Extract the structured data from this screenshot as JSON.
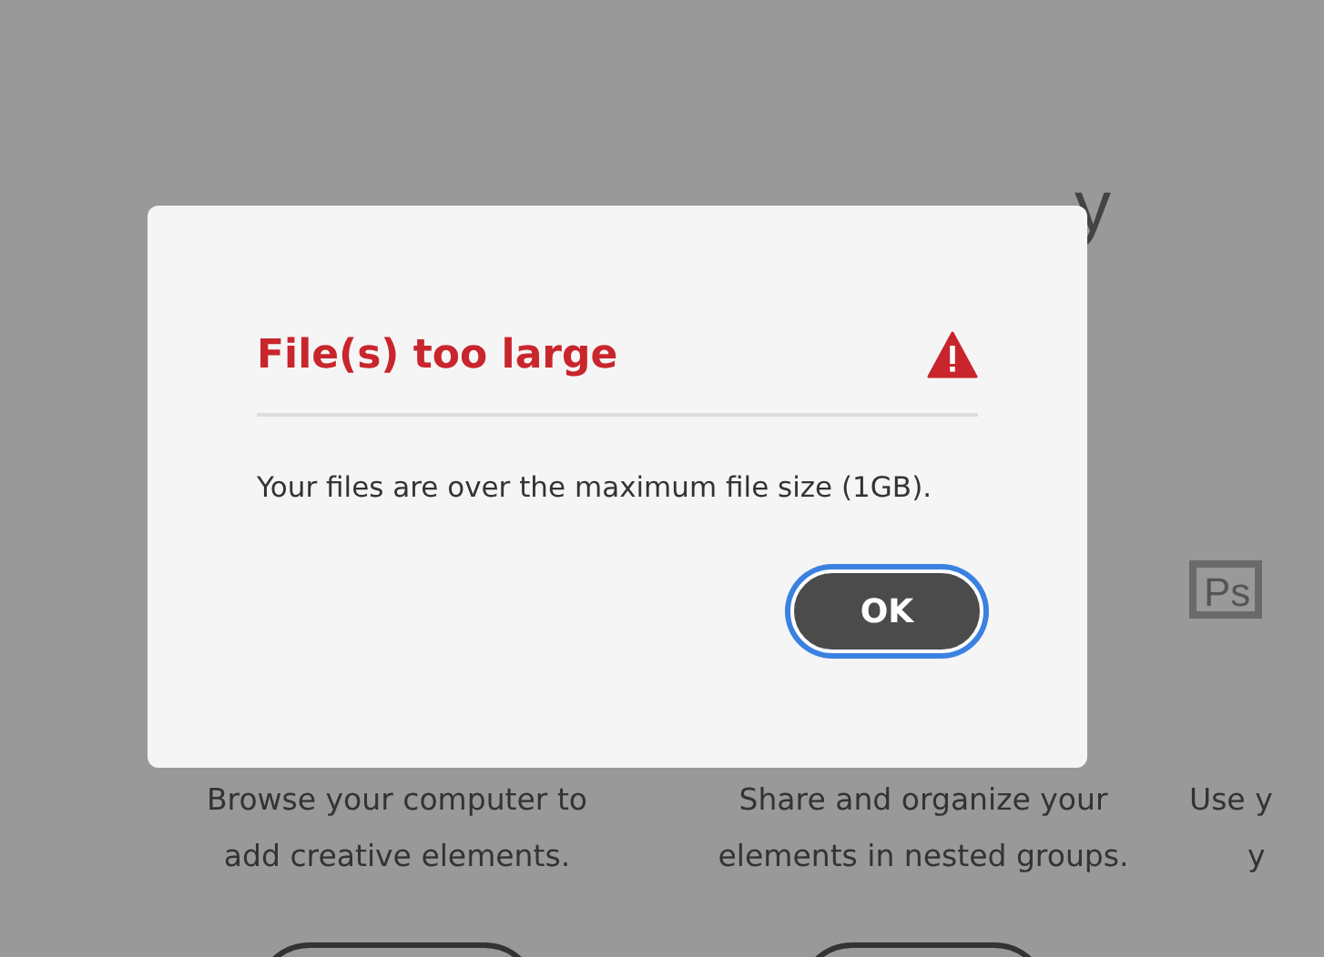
{
  "background": {
    "heading": "y",
    "columns": [
      {
        "lines": [
          "Browse your computer to",
          "add creative elements."
        ]
      },
      {
        "lines": [
          "Share and organize your",
          "elements in nested groups."
        ]
      },
      {
        "icon_label": "Ps",
        "lines": [
          "Use y",
          "y"
        ]
      }
    ]
  },
  "dialog": {
    "title": "File(s) too large",
    "message": "Your files are over the maximum file size (1GB).",
    "buttons": [
      {
        "label": "OK",
        "focused": true
      }
    ]
  }
}
